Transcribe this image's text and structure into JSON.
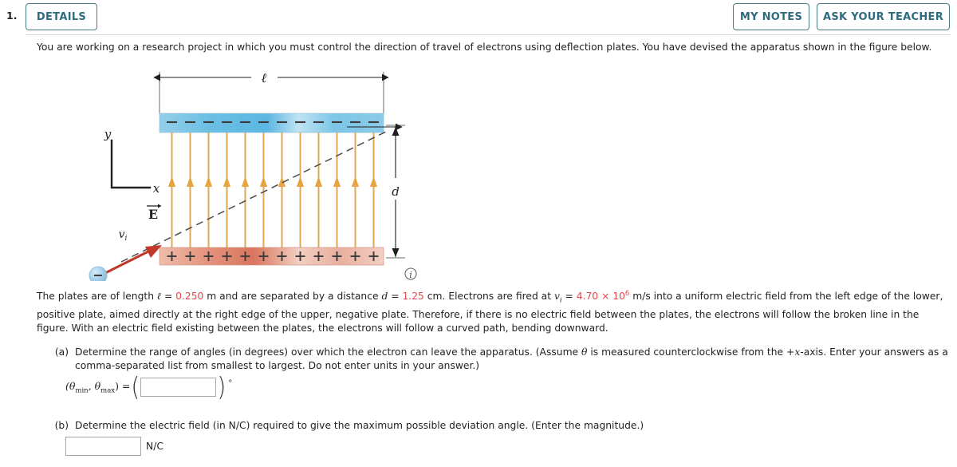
{
  "header": {
    "question_number": "1.",
    "details_label": "DETAILS",
    "my_notes_label": "MY NOTES",
    "ask_teacher_label": "ASK YOUR TEACHER"
  },
  "intro": {
    "text": "You are working on a research project in which you must control the direction of travel of electrons using deflection plates. You have devised the apparatus shown in the figure below."
  },
  "figure": {
    "length_label": "ℓ",
    "distance_label": "d",
    "x_axis_label": "x",
    "y_axis_label": "y",
    "field_label": "E",
    "velocity_label": "v",
    "velocity_sub": "i",
    "top_plate_charge": "–",
    "bottom_plate_charge": "+",
    "top_plate_charge_count": 12,
    "bottom_plate_charge_count": 12,
    "field_arrow_count": 12,
    "info_icon": "info-icon",
    "colors": {
      "top_plate": "#7dc4e8",
      "bottom_plate": "#e8a090",
      "field_arrow": "#e8a33d",
      "velocity_arrow": "#c0392b",
      "electron": "#a8cfe8",
      "dashed_path": "#4a4a4a"
    }
  },
  "plates_paragraph": {
    "seg1": "The plates are of length ",
    "sym_l": "ℓ",
    "eq1": " = ",
    "val_l": "0.250",
    "seg2": " m and are separated by a distance ",
    "sym_d": "d",
    "eq2": " = ",
    "val_d": "1.25",
    "seg3": " cm. Electrons are fired at ",
    "sym_v": "v",
    "sym_v_sub": "i",
    "eq3": " = ",
    "val_v": "4.70 × 10",
    "val_v_exp": "6",
    "seg4": " m/s into a uniform electric field from the left edge of the lower, positive plate, aimed directly at the right edge of the upper, negative plate. Therefore, if there is no electric field between the plates, the electrons will follow the broken line in the figure. With an electric field existing between the plates, the electrons will follow a curved path, bending downward."
  },
  "part_a": {
    "label": "(a)",
    "seg1": "Determine the range of angles (in degrees) over which the electron can leave the apparatus. (Assume ",
    "theta": "θ",
    "seg2": " is measured counterclockwise from the +",
    "x_ital": "x",
    "seg3": "-axis. Enter your answers as a comma-separated list from smallest to largest. Do not enter units in your answer.)",
    "answer_prefix": "(θ",
    "sub_min": "min",
    "comma": ", θ",
    "sub_max": "max",
    "equals": ") = ",
    "input_value": "",
    "input_placeholder": "",
    "degree_unit": "°"
  },
  "part_b": {
    "label": "(b)",
    "text": "Determine the electric field (in N/C) required to give the maximum possible deviation angle. (Enter the magnitude.)",
    "input_value": "",
    "input_placeholder": "",
    "unit": "N/C"
  }
}
